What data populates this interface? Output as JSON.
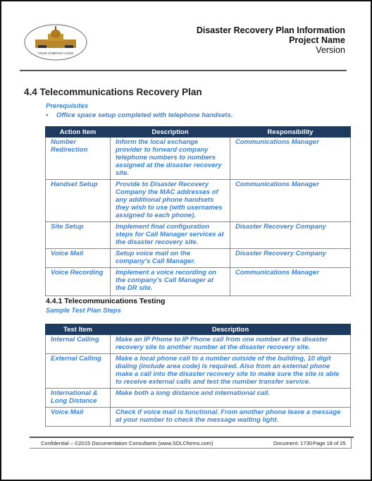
{
  "header": {
    "title": "Disaster Recovery Plan Information",
    "project": "Project Name",
    "version": "Version",
    "logo_text": "YOUR COMPANY LOGO"
  },
  "section": {
    "heading": "4.4  Telecommunications Recovery Plan",
    "prereq_label": "Prerequisites",
    "bullet": "Office space setup completed with telephone handsets."
  },
  "table1": {
    "headers": [
      "Action Item",
      "Description",
      "Responsibility"
    ],
    "rows": [
      [
        "Number Redirection",
        "Inform the local exchange provider to forward company telephone numbers to numbers assigned at the disaster recovery site.",
        "Communications Manager"
      ],
      [
        "Handset Setup",
        "Provide to Disaster Recovery Company the MAC addresses of any additional phone handsets they wish to use (with usernames assigned to each phone).",
        "Communications Manager"
      ],
      [
        "Site Setup",
        "Implement final configuration steps for   Call Manager services at the disaster recovery site.",
        "Disaster Recovery Company"
      ],
      [
        "Voice Mail",
        "Setup voice mail on the company's Call Manager.",
        "Disaster Recovery Company"
      ],
      [
        "Voice Recording",
        "Implement a voice recording on the company's Call Manager at the DR site.",
        "Communications Manager"
      ]
    ]
  },
  "subsection": {
    "heading": "4.4.1  Telecommunications Testing",
    "sub": "Sample Test Plan Steps"
  },
  "table2": {
    "headers": [
      "Test Item",
      "Description"
    ],
    "rows": [
      [
        "Internal Calling",
        "Make an IP Phone to IP Phone call from one number at the disaster recovery site to another number at the disaster recovery site."
      ],
      [
        "External Calling",
        "Make a local phone call to a number outside of the building, 10 digit dialing (include area code) is required.   Also from an external phone make a call into the disaster recovery site to make sure the site is able to receive external calls and test the number transfer service."
      ],
      [
        "International & Long Distance",
        "Make both a long distance and international call."
      ],
      [
        "Voice Mail",
        "Check if voice mail is functional.  From another phone leave a message at your number to check the message waiting light."
      ]
    ]
  },
  "footer": {
    "left": "Confidential – ©2015 Documentation Consultants (www.SDLCforms.com)",
    "doc": "Document: 1730",
    "page": "Page 18 of 25"
  }
}
